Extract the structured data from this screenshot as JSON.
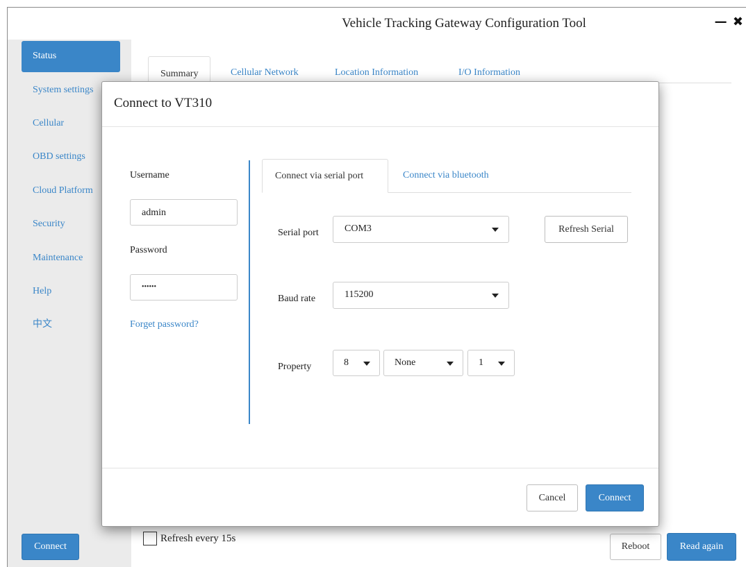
{
  "window": {
    "title": "Vehicle Tracking Gateway Configuration Tool",
    "minimize_glyph": "—",
    "close_glyph": "✖"
  },
  "sidebar": {
    "items": [
      {
        "label": "Status",
        "active": true
      },
      {
        "label": "System settings",
        "active": false
      },
      {
        "label": "Cellular",
        "active": false
      },
      {
        "label": "OBD settings",
        "active": false
      },
      {
        "label": "Cloud Platform",
        "active": false
      },
      {
        "label": "Security",
        "active": false
      },
      {
        "label": "Maintenance",
        "active": false
      },
      {
        "label": "Help",
        "active": false
      },
      {
        "label": "中文",
        "active": false
      }
    ],
    "connect_label": "Connect"
  },
  "main": {
    "tabs": [
      {
        "label": "Summary",
        "active": true
      },
      {
        "label": "Cellular Network",
        "active": false
      },
      {
        "label": "Location Information",
        "active": false
      },
      {
        "label": "I/O Information",
        "active": false
      }
    ]
  },
  "bottom": {
    "refresh_label": "Refresh every 15s",
    "refresh_checked": false,
    "reboot_label": "Reboot",
    "read_again_label": "Read again"
  },
  "dialog": {
    "title": "Connect to VT310",
    "username_label": "Username",
    "username_value": "admin",
    "password_label": "Password",
    "password_value": "••••••",
    "forgot_label": "Forget password?",
    "tabs": [
      {
        "label": "Connect via serial port",
        "active": true
      },
      {
        "label": "Connect via bluetooth",
        "active": false
      }
    ],
    "serial_port_label": "Serial port",
    "serial_port_value": "COM3",
    "refresh_serial_label": "Refresh Serial",
    "baud_rate_label": "Baud rate",
    "baud_rate_value": "115200",
    "property_label": "Property",
    "property_data_bits": "8",
    "property_parity": "None",
    "property_stop_bits": "1",
    "cancel_label": "Cancel",
    "connect_label": "Connect"
  },
  "colors": {
    "accent": "#3a86c8",
    "sidebar_bg": "#ebebeb"
  }
}
